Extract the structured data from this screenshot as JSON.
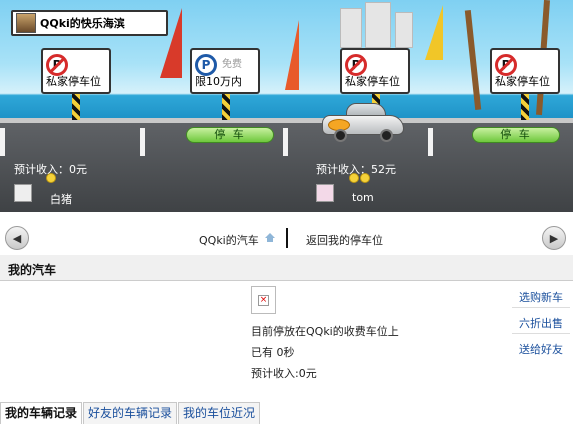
{
  "scene": {
    "title": "QQki的快乐海滨",
    "signs": [
      {
        "type": "private",
        "label": "私家停车位"
      },
      {
        "type": "free",
        "free_text": "免费",
        "label": "限10万内"
      },
      {
        "type": "private",
        "label": "私家停车位"
      },
      {
        "type": "private",
        "label": "私家停车位"
      }
    ],
    "park_buttons": [
      "停 车",
      "停 车"
    ],
    "owners": [
      {
        "income": "预计收入：0元",
        "name": "白猪"
      },
      {
        "income": "预计收入：52元",
        "name": "tom"
      }
    ]
  },
  "nav": {
    "left_link": "QQki的汽车",
    "right_link": "返回我的停车位"
  },
  "section": {
    "title": "我的汽车"
  },
  "car_info": {
    "line1": "目前停放在QQki的收费车位上",
    "line2": "已有 0秒",
    "line3": "预计收入:0元"
  },
  "side_links": [
    "选购新车",
    "六折出售",
    "送给好友"
  ],
  "tabs": [
    "我的车辆记录",
    "好友的车辆记录",
    "我的车位近况"
  ],
  "colors": {
    "link": "#1a4f9c",
    "park_button": "#6ec83c",
    "no_parking": "#d62b2b"
  }
}
